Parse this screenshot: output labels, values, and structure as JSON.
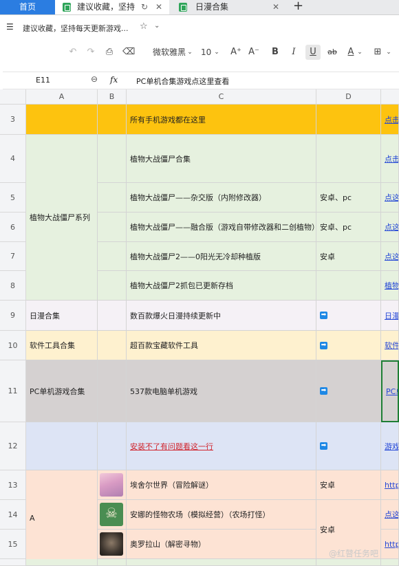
{
  "tabs": {
    "home": "首页",
    "tab1": "建议收藏，坚持",
    "tab2": "日漫合集"
  },
  "title": {
    "menu_icon": "☰",
    "doc_title": "建议收藏，坚持每天更新游戏..."
  },
  "toolbar": {
    "font_name": "微软雅黑",
    "font_size": "10",
    "grow_font": "A⁺",
    "shrink_font": "A⁻",
    "bold": "B",
    "italic": "I",
    "underline": "U",
    "strike": "ab",
    "font_color": "A"
  },
  "formula": {
    "cell_ref": "E11",
    "fx": "fx",
    "content": "PC单机合集游戏点这里查看"
  },
  "columns": [
    "A",
    "B",
    "C",
    "D"
  ],
  "rows": {
    "r3": {
      "num": "3",
      "c": "所有手机游戏都在这里",
      "e": "点击"
    },
    "r4": {
      "num": "4",
      "c": "植物大战僵尸合集",
      "e": "点击"
    },
    "r5": {
      "num": "5",
      "c": "植物大战僵尸——杂交版（内附修改器）",
      "d": "安卓、pc",
      "e": "点这"
    },
    "r6": {
      "num": "6",
      "c": "植物大战僵尸——融合版（游戏自带修改器和二创植物）",
      "d": "安卓、pc",
      "e": "点这"
    },
    "r7": {
      "num": "7",
      "c": "植物大战僵尸2——0阳光无冷却种植版",
      "d": "安卓",
      "e": "点这"
    },
    "r8": {
      "num": "8",
      "c": "植物大战僵尸2抓包已更新存档",
      "e": "植物"
    },
    "r9": {
      "num": "9",
      "a": "日漫合集",
      "c": "数百款爆火日漫持续更新中",
      "e": "日漫"
    },
    "r10": {
      "num": "10",
      "a": "软件工具合集",
      "c": "超百款宝藏软件工具",
      "e": "软件"
    },
    "r11": {
      "num": "11",
      "a": "PC单机游戏合集",
      "c": "537款电脑单机游戏",
      "e": "PC单"
    },
    "r12": {
      "num": "12",
      "c": "安装不了有问题看这一行",
      "e": "游戏"
    },
    "r13": {
      "num": "13",
      "c": "埃舍尔世界（冒险解谜）",
      "d": "安卓",
      "e": "http"
    },
    "r14": {
      "num": "14",
      "c": "安娜的怪物农场（模拟经营）（农场打怪）",
      "e": "点这"
    },
    "r15": {
      "num": "15",
      "c": "奥罗拉山（解密寻物）",
      "d": "安卓",
      "e": "http"
    }
  },
  "merged": {
    "a_pvz": "植物大战僵尸系列",
    "a_games": "A",
    "d_14": "安卓"
  },
  "arrow_glyph": "➡",
  "watermark": "@红瞽任务吧",
  "colors": {
    "orange": "#fdc30f",
    "green": "#e6f1df",
    "lavender": "#f5f1f6",
    "cream": "#fef1cf",
    "gray": "#d5d1d1",
    "blue": "#dde4f5",
    "peach": "#fde3d4",
    "accent": "#2b7de1"
  }
}
